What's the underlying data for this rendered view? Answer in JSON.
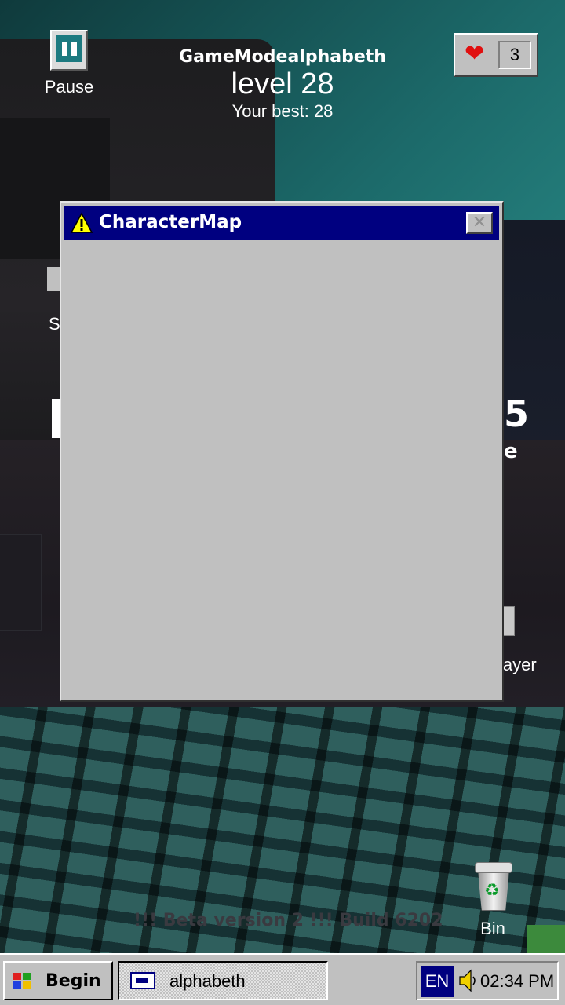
{
  "hud": {
    "pause_label": "Pause",
    "mode_label": "GameModealphabeth",
    "level_text": "level 28",
    "best_text": "Your best: 28",
    "lives": "3"
  },
  "dialog": {
    "title": "CharacterMap",
    "close_glyph": "✕"
  },
  "desktop": {
    "ghost_s": "S",
    "ghost_player": "layer",
    "ghost_logo": "5",
    "ghost_e": "e",
    "recycle_bin_label": "Bin",
    "watermark": "!!! Beta version 2 !!! Build 6202"
  },
  "taskbar": {
    "start_label": "Begin",
    "task_label": "alphabeth",
    "language": "EN",
    "clock": "02:34 PM"
  },
  "colors": {
    "titlebar": "#000080",
    "window_face": "#c0c0c0",
    "heart": "#e01010"
  }
}
